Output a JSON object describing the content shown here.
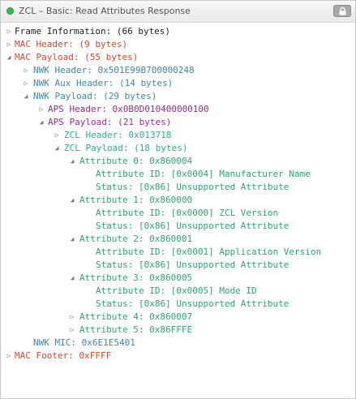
{
  "window": {
    "title": "ZCL – Basic: Read Attributes Response",
    "status_color": "#2fbf4a",
    "lock_icon": "lock-icon"
  },
  "tree": {
    "frame_info": "Frame Information: (66 bytes)",
    "mac_header": "MAC Header: (9 bytes)",
    "mac_payload": "MAC Payload: (55 bytes)",
    "nwk_header": "NWK Header: 0x501E99B700000248",
    "nwk_aux_header": "NWK Aux Header: (14 bytes)",
    "nwk_payload": "NWK Payload: (29 bytes)",
    "aps_header": "APS Header: 0x0B0D010400000100",
    "aps_payload": "APS Payload: (21 bytes)",
    "zcl_header": "ZCL Header: 0x013718",
    "zcl_payload": "ZCL Payload: (18 bytes)",
    "attributes": [
      {
        "label": "Attribute 0: 0x860004",
        "id": "Attribute ID: [0x0004] Manufacturer Name",
        "status": "Status: [0x86] Unsupported Attribute"
      },
      {
        "label": "Attribute 1: 0x860000",
        "id": "Attribute ID: [0x0000] ZCL Version",
        "status": "Status: [0x86] Unsupported Attribute"
      },
      {
        "label": "Attribute 2: 0x860001",
        "id": "Attribute ID: [0x0001] Application Version",
        "status": "Status: [0x86] Unsupported Attribute"
      },
      {
        "label": "Attribute 3: 0x860005",
        "id": "Attribute ID: [0x0005] Mode ID",
        "status": "Status: [0x86] Unsupported Attribute"
      },
      {
        "label": "Attribute 4: 0x860007"
      },
      {
        "label": "Attribute 5: 0x86FFFE"
      }
    ],
    "nwk_mic": "NWK MIC: 0x6E1E5401",
    "mac_footer": "MAC Footer: 0xFFFF"
  },
  "colors": {
    "frame": "#1d1d1d",
    "mac": "#d64a2b",
    "nwk": "#3f86b0",
    "aps": "#9a2c8e",
    "zcl": "#2db08a",
    "attribute": "#2aa772"
  }
}
